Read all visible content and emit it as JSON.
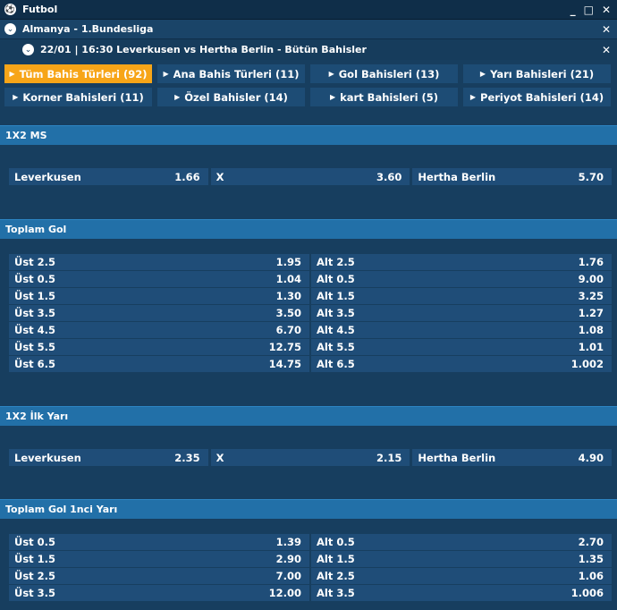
{
  "header": {
    "sport": "Futbol",
    "league": "Almanya - 1.Bundesliga",
    "match": "22/01 | 16:30 Leverkusen vs Hertha Berlin - Bütün Bahisler",
    "min": "_",
    "restore": "□",
    "close": "✕"
  },
  "icons": {
    "soccer": "soccer-ball-icon",
    "chevron": "chevron-down-icon",
    "close": "close-icon",
    "tab_arrow": "triangle-right-icon"
  },
  "colors": {
    "accent": "#f7a518",
    "section": "#2270a8",
    "cell": "#1f4d78",
    "bg": "#173e5f"
  },
  "tabs": [
    {
      "label": "Tüm Bahis Türleri (92)"
    },
    {
      "label": "Ana Bahis Türleri (11)"
    },
    {
      "label": "Gol Bahisleri (13)"
    },
    {
      "label": "Yarı Bahisleri (21)"
    },
    {
      "label": "Korner Bahisleri (11)"
    },
    {
      "label": "Özel Bahisler (14)"
    },
    {
      "label": "kart Bahisleri (5)"
    },
    {
      "label": "Periyot Bahisleri (14)"
    }
  ],
  "sections": {
    "ms": {
      "title": "1X2 MS",
      "row": [
        {
          "label": "Leverkusen",
          "odd": "1.66"
        },
        {
          "label": "X",
          "odd": "3.60"
        },
        {
          "label": "Hertha Berlin",
          "odd": "5.70"
        }
      ]
    },
    "total": {
      "title": "Toplam Gol",
      "rows": [
        [
          {
            "label": "Üst 2.5",
            "odd": "1.95"
          },
          {
            "label": "Alt 2.5",
            "odd": "1.76"
          }
        ],
        [
          {
            "label": "Üst 0.5",
            "odd": "1.04"
          },
          {
            "label": "Alt 0.5",
            "odd": "9.00"
          }
        ],
        [
          {
            "label": "Üst 1.5",
            "odd": "1.30"
          },
          {
            "label": "Alt 1.5",
            "odd": "3.25"
          }
        ],
        [
          {
            "label": "Üst 3.5",
            "odd": "3.50"
          },
          {
            "label": "Alt 3.5",
            "odd": "1.27"
          }
        ],
        [
          {
            "label": "Üst 4.5",
            "odd": "6.70"
          },
          {
            "label": "Alt 4.5",
            "odd": "1.08"
          }
        ],
        [
          {
            "label": "Üst 5.5",
            "odd": "12.75"
          },
          {
            "label": "Alt 5.5",
            "odd": "1.01"
          }
        ],
        [
          {
            "label": "Üst 6.5",
            "odd": "14.75"
          },
          {
            "label": "Alt 6.5",
            "odd": "1.002"
          }
        ]
      ]
    },
    "ht": {
      "title": "1X2 İlk Yarı",
      "row": [
        {
          "label": "Leverkusen",
          "odd": "2.35"
        },
        {
          "label": "X",
          "odd": "2.15"
        },
        {
          "label": "Hertha Berlin",
          "odd": "4.90"
        }
      ]
    },
    "total_ht": {
      "title": "Toplam Gol 1nci Yarı",
      "rows": [
        [
          {
            "label": "Üst 0.5",
            "odd": "1.39"
          },
          {
            "label": "Alt 0.5",
            "odd": "2.70"
          }
        ],
        [
          {
            "label": "Üst 1.5",
            "odd": "2.90"
          },
          {
            "label": "Alt 1.5",
            "odd": "1.35"
          }
        ],
        [
          {
            "label": "Üst 2.5",
            "odd": "7.00"
          },
          {
            "label": "Alt 2.5",
            "odd": "1.06"
          }
        ],
        [
          {
            "label": "Üst 3.5",
            "odd": "12.00"
          },
          {
            "label": "Alt 3.5",
            "odd": "1.006"
          }
        ]
      ]
    }
  }
}
